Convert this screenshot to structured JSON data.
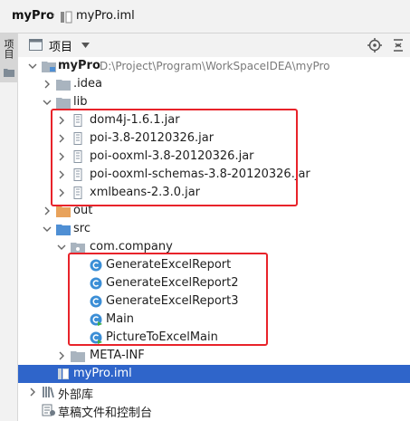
{
  "breadcrumb": {
    "project": "myPro",
    "file": "myPro.iml"
  },
  "side_strip": {
    "tab_label": "项目"
  },
  "panel": {
    "title": "项目"
  },
  "tree": {
    "root": {
      "label": "myPro",
      "path": "D:\\Project\\Program\\WorkSpaceIDEA\\myPro"
    },
    "idea": ".idea",
    "lib": {
      "label": "lib",
      "jars": [
        "dom4j-1.6.1.jar",
        "poi-3.8-20120326.jar",
        "poi-ooxml-3.8-20120326.jar",
        "poi-ooxml-schemas-3.8-20120326.jar",
        "xmlbeans-2.3.0.jar"
      ]
    },
    "out": "out",
    "src": "src",
    "package": "com.company",
    "classes": [
      {
        "label": "GenerateExcelReport",
        "kind": "class"
      },
      {
        "label": "GenerateExcelReport2",
        "kind": "class"
      },
      {
        "label": "GenerateExcelReport3",
        "kind": "class"
      },
      {
        "label": "Main",
        "kind": "main-class"
      },
      {
        "label": "PictureToExcelMain",
        "kind": "main-class"
      }
    ],
    "meta_inf": "META-INF",
    "iml": "myPro.iml",
    "external_libraries": "外部库",
    "scratches": "草稿文件和控制台"
  },
  "colors": {
    "folder": "#a9b4bf",
    "folder_excluded": "#e8a25b",
    "folder_source": "#4f8fd4",
    "class_icon": "#3b8ed6",
    "selection": "#2f65ca",
    "highlight_box": "#e8232a"
  }
}
